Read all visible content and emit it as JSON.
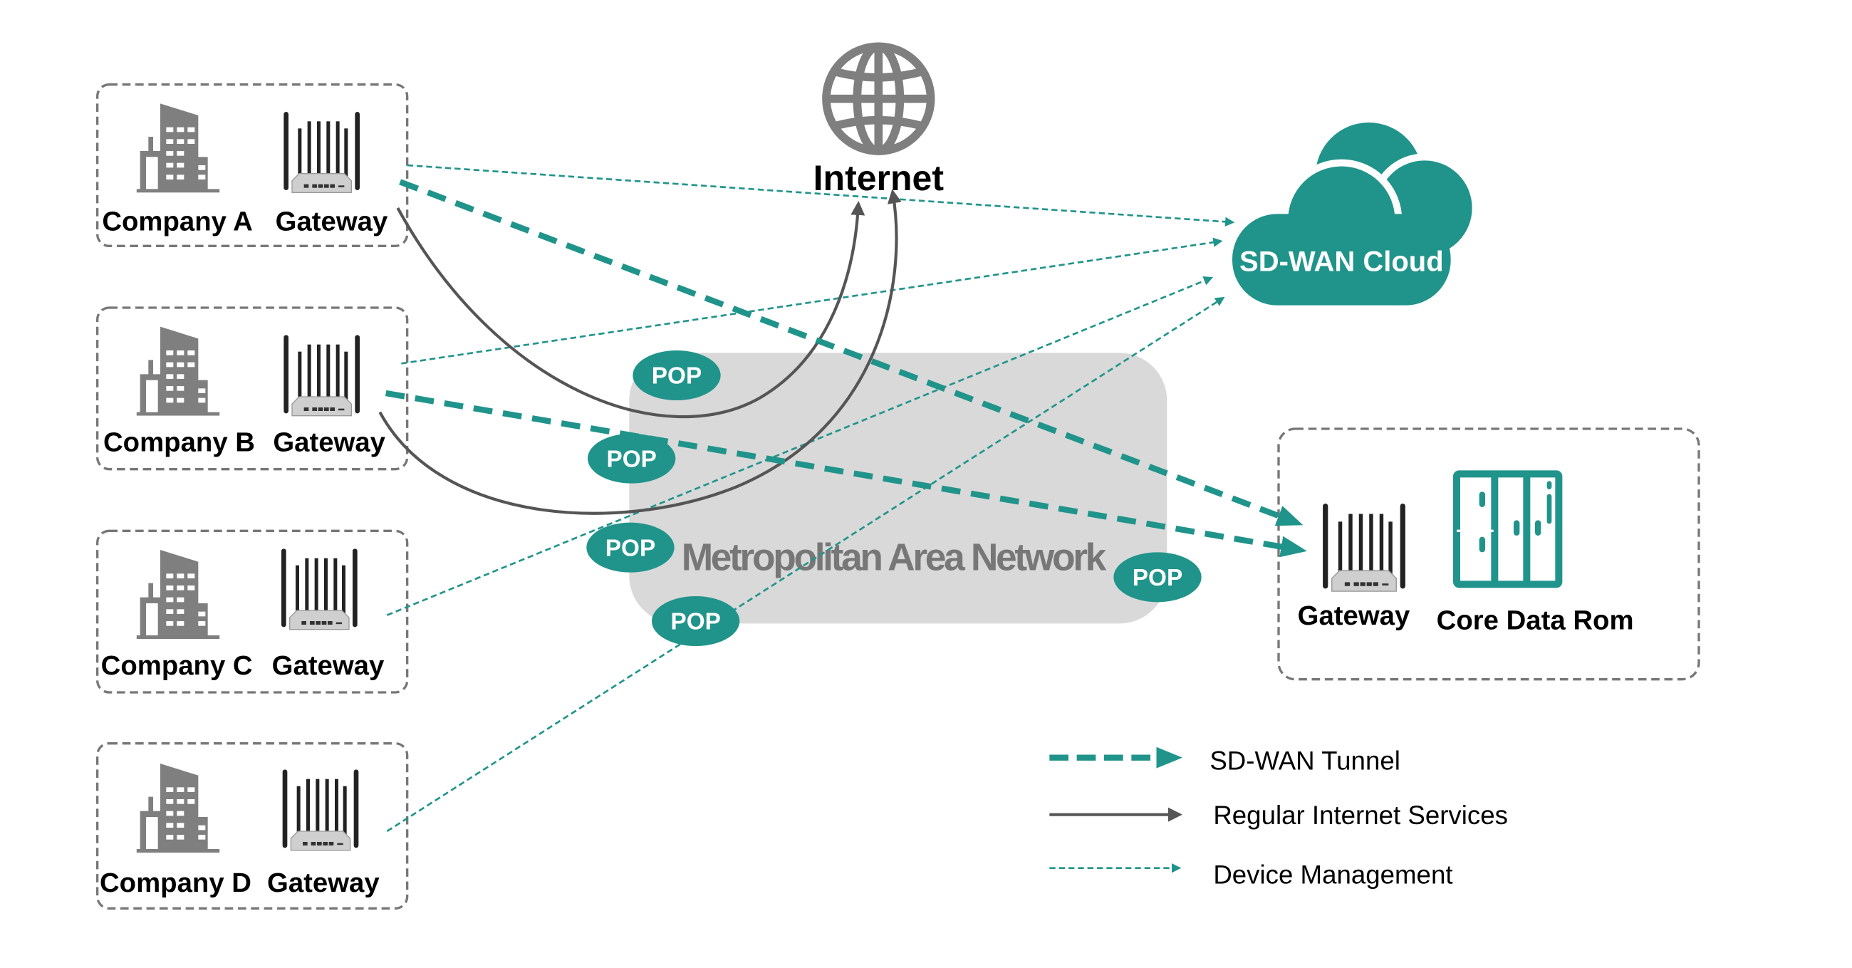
{
  "companies": [
    {
      "name": "Company A",
      "device": "Gateway"
    },
    {
      "name": "Company B",
      "device": "Gateway"
    },
    {
      "name": "Company C",
      "device": "Gateway"
    },
    {
      "name": "Company D",
      "device": "Gateway"
    }
  ],
  "internet": {
    "label": "Internet"
  },
  "cloud": {
    "label": "SD-WAN Cloud"
  },
  "man": {
    "label": "Metropolitan Area Network",
    "pops": [
      "POP",
      "POP",
      "POP",
      "POP",
      "POP"
    ]
  },
  "datacenter": {
    "gateway": "Gateway",
    "core": "Core Data Rom"
  },
  "legend": [
    {
      "label": "SD-WAN Tunnel",
      "style": "thick-dashed",
      "color": "#20948b"
    },
    {
      "label": "Regular Internet Services",
      "style": "solid",
      "color": "#555555"
    },
    {
      "label": "Device Management",
      "style": "thin-dashed",
      "color": "#20948b"
    }
  ],
  "colors": {
    "accent": "#20948b",
    "gray": "#7f7f7f",
    "man_bg": "#d9d9d9"
  }
}
